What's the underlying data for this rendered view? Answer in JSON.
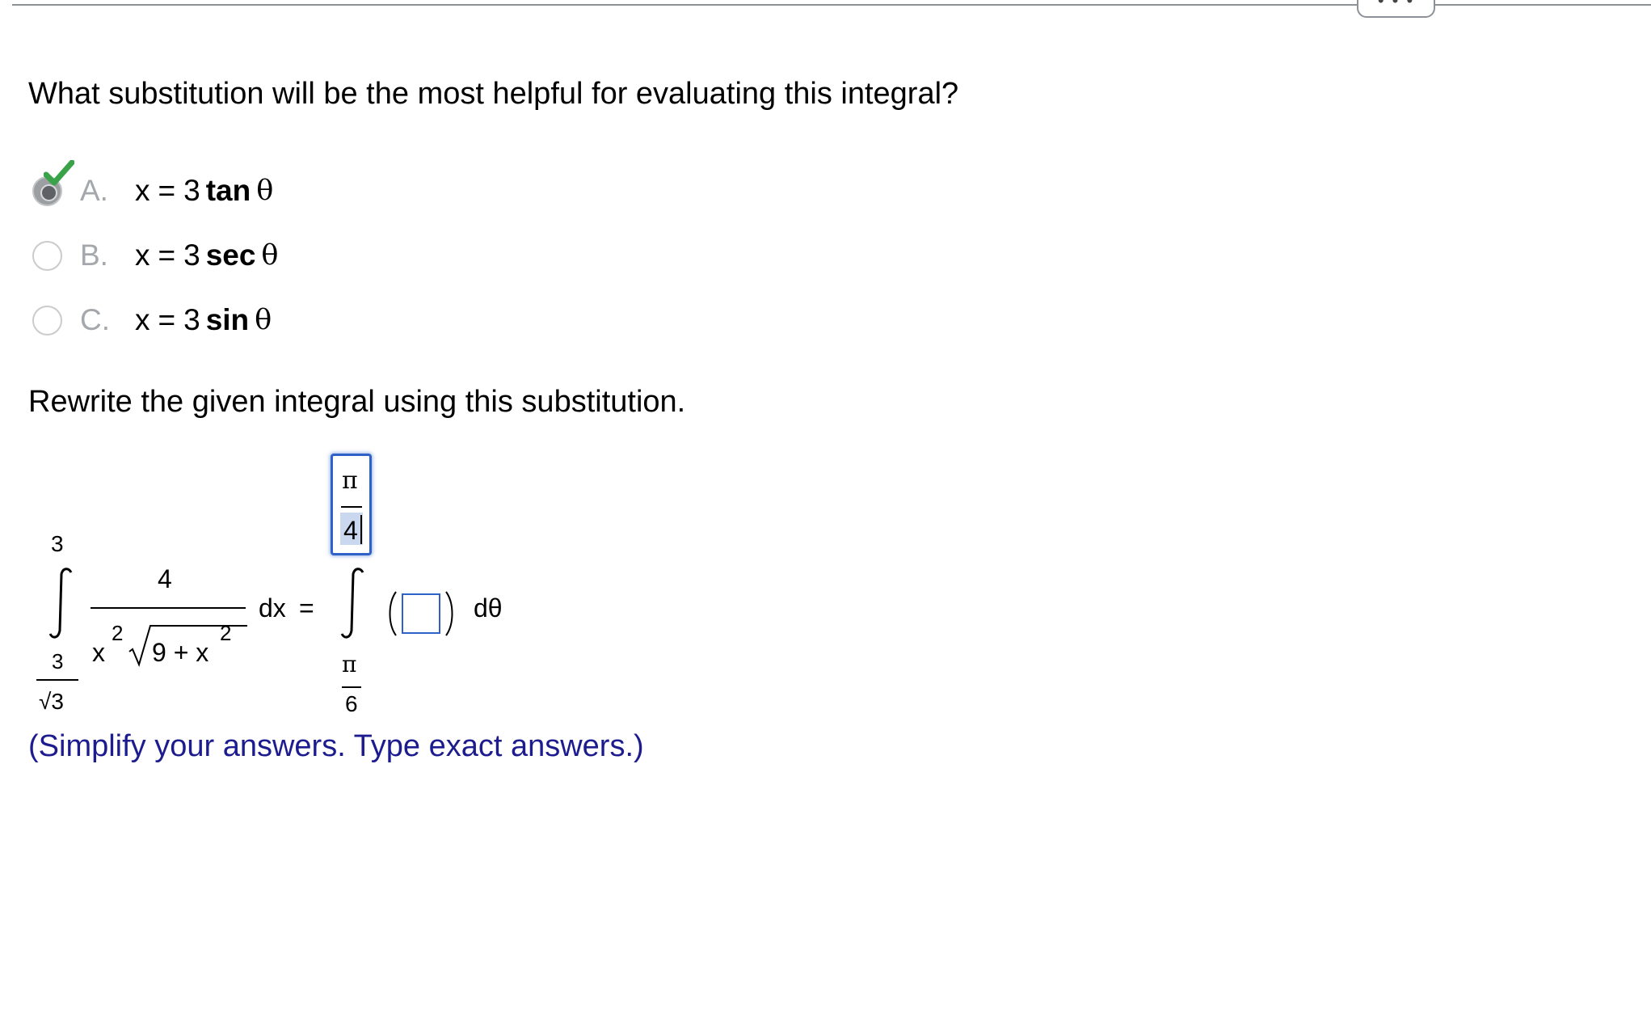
{
  "toolbar": {
    "more_label": "• • •"
  },
  "question": "What substitution will be the most helpful for evaluating this integral?",
  "options": [
    {
      "letter": "A.",
      "var": "x",
      "eq": "=",
      "num": "3",
      "fn": "tan",
      "theta": "θ",
      "selected": true,
      "correct": true
    },
    {
      "letter": "B.",
      "var": "x",
      "eq": "=",
      "num": "3",
      "fn": "sec",
      "theta": "θ",
      "selected": false
    },
    {
      "letter": "C.",
      "var": "x",
      "eq": "=",
      "num": "3",
      "fn": "sin",
      "theta": "θ",
      "selected": false
    }
  ],
  "instruction": "Rewrite the given integral using this substitution.",
  "integral": {
    "lhs": {
      "upper_limit": "3",
      "lower_limit_num": "3",
      "lower_limit_den": "√3",
      "integrand_num": "4",
      "den_x": "x",
      "den_x_exp": "2",
      "den_radicand": "9 + x",
      "den_radicand_exp": "2",
      "differential": "dx",
      "equals": "="
    },
    "rhs": {
      "upper_limit_num": "π",
      "upper_limit_den_value": "4",
      "lower_limit_num": "π",
      "lower_limit_den": "6",
      "integrand_value": "",
      "differential": "dθ"
    }
  },
  "hint": "(Simplify your answers. Type exact answers.)",
  "colors": {
    "accent": "#2f62c9",
    "hint": "#1c1c8f",
    "check": "#3aa34a"
  }
}
